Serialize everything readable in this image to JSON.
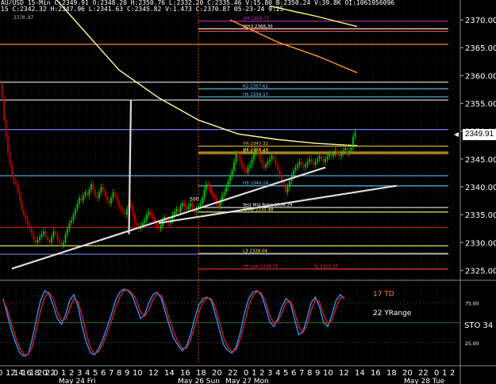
{
  "header": {
    "line1": "AU/USD  15-Min  C:2349.91  O:2348.20  H:2350.76  L:2332.20  C:2335.46  V:15.80  B:2350.24  V:39.8K  OI:1061956096",
    "line2": "15  C:2342.32  H:2347.96  L:2341.63  C:2345.82  V:1.473  C:2370.87  05-23-24  9:25",
    "line3": "2370.87"
  },
  "current_price_label": "2349.91",
  "indicator_labels": {
    "td": "17 TD",
    "yrange": "22 YRange",
    "sto": "STO  34"
  },
  "colors": {
    "background": "#000000",
    "candle_up": "#00cc00",
    "candle_down": "#cc0000",
    "stoch_k": "#3399ff",
    "stoch_d": "#dd2222",
    "td_label": "#ff7f27"
  },
  "chart_data": [
    {
      "type": "line",
      "title": "",
      "y_axis_right": true,
      "ylim": [
        2323.5,
        2373.0
      ],
      "y_ticks": [
        "2325.00",
        "2330.00",
        "2335.00",
        "2340.00",
        "2345.00",
        "2350.00",
        "2355.00",
        "2360.00",
        "2365.00",
        "2370.00"
      ],
      "y_tick_values": [
        2325,
        2330,
        2335,
        2340,
        2345,
        2350,
        2355,
        2360,
        2365,
        2370
      ],
      "x_tick_labels": [
        "0",
        "12",
        "14",
        "16",
        "18",
        "20",
        "22",
        "0",
        "1",
        "2",
        "3",
        "4",
        "5",
        "6",
        "7",
        "8",
        "9",
        "10",
        "12",
        "14",
        "16",
        "18",
        "20",
        "22",
        "0",
        "1",
        "2",
        "3",
        "4",
        "5",
        "6",
        "7",
        "8",
        "9",
        "10",
        "12",
        "14",
        "16",
        "18",
        "20",
        "22",
        "0",
        "1",
        "2"
      ],
      "x_tick_bars": [
        0,
        4,
        8,
        12,
        16,
        20,
        24,
        28,
        32,
        36,
        40,
        44,
        48,
        52,
        56,
        60,
        64,
        68,
        76,
        84,
        92,
        100,
        108,
        116,
        124,
        128,
        132,
        136,
        140,
        144,
        148,
        152,
        156,
        160,
        164,
        172,
        180,
        188,
        196,
        204,
        212,
        220,
        224,
        228
      ],
      "date_labels": [
        {
          "text": "May 24 Fri",
          "bar": 40
        },
        {
          "text": "May 26 Sun",
          "bar": 100
        },
        {
          "text": "May 27 Mon",
          "bar": 124
        },
        {
          "text": "May 28 Tue",
          "bar": 214
        }
      ],
      "session_divider_bar": 100,
      "last_bar": 180,
      "close_series": [
        2358.5,
        2356.0,
        2352.0,
        2349.0,
        2346.0,
        2344.0,
        2342.0,
        2341.0,
        2340.5,
        2339.0,
        2337.5,
        2336.0,
        2335.0,
        2334.0,
        2333.0,
        2332.5,
        2331.5,
        2330.5,
        2330.0,
        2330.5,
        2331.0,
        2331.5,
        2332.0,
        2331.0,
        2330.5,
        2330.0,
        2331.0,
        2332.0,
        2331.5,
        2330.5,
        2330.0,
        2329.5,
        2330.0,
        2331.5,
        2332.5,
        2333.5,
        2334.0,
        2335.0,
        2336.0,
        2337.0,
        2338.0,
        2337.5,
        2338.5,
        2339.0,
        2338.5,
        2339.5,
        2340.5,
        2339.5,
        2338.5,
        2338.0,
        2339.0,
        2340.0,
        2339.5,
        2338.5,
        2337.5,
        2337.0,
        2338.0,
        2339.0,
        2338.5,
        2337.5,
        2336.5,
        2336.0,
        2335.5,
        2335.0,
        2336.0,
        2337.0,
        2336.5,
        2335.0,
        2333.5,
        2333.0,
        2332.5,
        2333.0,
        2333.5,
        2334.0,
        2335.0,
        2335.5,
        2335.0,
        2334.5,
        2333.5,
        2333.0,
        2332.5,
        2333.0,
        2334.0,
        2334.5,
        2334.0,
        2333.5,
        2334.0,
        2335.0,
        2335.5,
        2336.0,
        2335.5,
        2336.5,
        2337.0,
        2336.5,
        2336.0,
        2336.5,
        2337.0,
        2336.0,
        2335.5,
        2336.0,
        2336.5,
        2337.0,
        2338.0,
        2339.5,
        2340.5,
        2340.0,
        2339.0,
        2338.5,
        2338.0,
        2337.0,
        2336.5,
        2337.5,
        2338.5,
        2339.0,
        2340.0,
        2341.0,
        2342.0,
        2343.0,
        2344.5,
        2346.0,
        2345.5,
        2344.5,
        2343.5,
        2343.0,
        2342.5,
        2343.5,
        2344.0,
        2345.0,
        2346.0,
        2346.5,
        2346.0,
        2345.0,
        2344.0,
        2343.5,
        2344.0,
        2344.5,
        2345.0,
        2345.5,
        2345.0,
        2344.0,
        2343.0,
        2342.0,
        2341.0,
        2340.0,
        2339.0,
        2340.0,
        2341.0,
        2342.0,
        2343.0,
        2343.5,
        2344.0,
        2344.5,
        2344.0,
        2343.5,
        2344.0,
        2344.5,
        2345.0,
        2344.5,
        2344.0,
        2344.5,
        2345.0,
        2345.5,
        2345.0,
        2344.5,
        2345.0,
        2345.5,
        2346.0,
        2345.5,
        2346.0,
        2346.5,
        2346.0,
        2345.5,
        2346.0,
        2346.5,
        2347.0,
        2346.0,
        2346.5,
        2347.0,
        2349.0,
        2349.91
      ],
      "moving_averages": [
        {
          "name": "",
          "color": "#ffff99",
          "points": [
            [
              20,
              2377
            ],
            [
              40,
              2369
            ],
            [
              60,
              2361
            ],
            [
              80,
              2356
            ],
            [
              100,
              2352
            ],
            [
              120,
              2349.5
            ],
            [
              140,
              2348.5
            ],
            [
              160,
              2347.8
            ],
            [
              180,
              2347.4
            ]
          ]
        },
        {
          "name": "",
          "color": "#ff9933",
          "points": [
            [
              116,
              2370
            ],
            [
              140,
              2366
            ],
            [
              160,
              2363.5
            ],
            [
              180,
              2360.5
            ]
          ]
        },
        {
          "name": "",
          "color": "#ffff66",
          "points": [
            [
              136,
              2372.5
            ],
            [
              160,
              2370.6
            ],
            [
              180,
              2368.8
            ]
          ]
        }
      ],
      "trendlines": [
        {
          "color": "#dddddd",
          "points": [
            [
              6,
              2325.3
            ],
            [
              164,
              2343.5
            ]
          ]
        },
        {
          "color": "#dddddd",
          "points": [
            [
              80,
              2333.5
            ],
            [
              200,
              2340.2
            ]
          ]
        },
        {
          "color": "#dddddd",
          "points": [
            [
              65,
              2331.5
            ],
            [
              66,
              2355.5
            ]
          ]
        }
      ],
      "levels": [
        {
          "value": 2369.77,
          "color": "#cc33cc",
          "from_bar": 100,
          "label": "WP  2369.77"
        },
        {
          "value": 2368.39,
          "color": "#ffffff",
          "from_bar": 100,
          "label": "WH3  2368.39"
        },
        {
          "value": 2367.95,
          "color": "#ff5555",
          "from_bar": 100,
          "label": "R3  2367.95"
        },
        {
          "value": 2357.62,
          "color": "#66ccff",
          "from_bar": 100,
          "label": "R2  2357.62"
        },
        {
          "value": 2356.17,
          "color": "#66ccff",
          "from_bar": 100,
          "label": "H5  2356.17"
        },
        {
          "value": 2347.32,
          "color": "#ffcc33",
          "from_bar": 100,
          "label": "YH  2347.32"
        },
        {
          "value": 2346.24,
          "color": "#ffcc33",
          "from_bar": 100,
          "label": "H4  2346.24"
        },
        {
          "value": 2345.97,
          "color": "#ffcc33",
          "from_bar": 100,
          "label": "R1  2345.97"
        },
        {
          "value": 2340.18,
          "color": "#66ccff",
          "from_bar": 100,
          "label": "H3  2340.18"
        },
        {
          "value": 2336.29,
          "color": "#ffffff",
          "from_bar": 100,
          "label": "Yest Mid Point  2336.29"
        },
        {
          "value": 2335.48,
          "color": "#ffff66",
          "from_bar": 100,
          "label": "RMW  2335.48"
        },
        {
          "value": 2328.04,
          "color": "#ffff66",
          "from_bar": 100,
          "label": "L3  2328.04"
        },
        {
          "value": 2325.25,
          "color": "#ff3333",
          "from_bar": 100,
          "label": "YH Low  2325.25"
        },
        {
          "value": 2325.25,
          "color": "#ff3333",
          "from_bar": 158,
          "label": "YL  2325.25"
        },
        {
          "value": 2365.6,
          "color": "#ff9933",
          "from_bar": 0,
          "label": ""
        },
        {
          "value": 2358.8,
          "color": "#ffffff",
          "from_bar": 0,
          "label": ""
        },
        {
          "value": 2355.6,
          "color": "#ffffff",
          "from_bar": 0,
          "label": ""
        },
        {
          "value": 2350.3,
          "color": "#8888ff",
          "from_bar": 0,
          "label": ""
        },
        {
          "value": 2329.4,
          "color": "#ffff66",
          "from_bar": 0,
          "label": ""
        },
        {
          "value": 2332.7,
          "color": "#dd2222",
          "from_bar": 0,
          "label": ""
        },
        {
          "value": 2327.9,
          "color": "#8888ff",
          "from_bar": 0,
          "label": ""
        },
        {
          "value": 2342.0,
          "color": "#66ccff",
          "from_bar": 0,
          "label": ""
        }
      ],
      "annotations": [
        {
          "text": "500",
          "bar": 98,
          "value": 2337.5
        }
      ]
    },
    {
      "type": "line",
      "title": "STO",
      "ylim": [
        0,
        100
      ],
      "y_ticks": [
        "75.00",
        "25.00"
      ],
      "y_tick_values": [
        75,
        25
      ],
      "series": [
        {
          "name": "",
          "color": "#3399ff",
          "values": [
            80,
            60,
            40,
            25,
            12,
            8,
            10,
            30,
            55,
            78,
            90,
            86,
            72,
            55,
            48,
            60,
            78,
            85,
            70,
            45,
            25,
            12,
            10,
            18,
            30,
            45,
            60,
            78,
            88,
            92,
            90,
            84,
            70,
            55,
            60,
            75,
            85,
            88,
            80,
            62,
            45,
            30,
            22,
            15,
            20,
            35,
            55,
            72,
            80,
            82,
            78,
            60,
            40,
            22,
            15,
            12,
            20,
            38,
            62,
            80,
            88,
            90,
            85,
            70,
            52,
            45,
            55,
            70,
            80,
            75,
            55,
            35,
            38,
            55,
            75,
            82,
            70,
            50,
            45,
            60,
            78,
            85,
            80
          ]
        },
        {
          "name": "",
          "color": "#dd2222",
          "values": [
            78,
            66,
            48,
            32,
            18,
            10,
            10,
            20,
            42,
            65,
            82,
            88,
            80,
            64,
            52,
            54,
            68,
            80,
            76,
            58,
            36,
            18,
            11,
            14,
            24,
            38,
            52,
            68,
            82,
            90,
            91,
            87,
            78,
            63,
            58,
            66,
            79,
            86,
            84,
            70,
            53,
            38,
            26,
            18,
            18,
            28,
            45,
            63,
            76,
            81,
            80,
            68,
            50,
            31,
            19,
            14,
            16,
            30,
            50,
            71,
            84,
            89,
            87,
            77,
            60,
            49,
            51,
            63,
            75,
            77,
            64,
            45,
            37,
            47,
            65,
            79,
            76,
            60,
            48,
            53,
            69,
            81,
            82
          ]
        }
      ]
    }
  ]
}
